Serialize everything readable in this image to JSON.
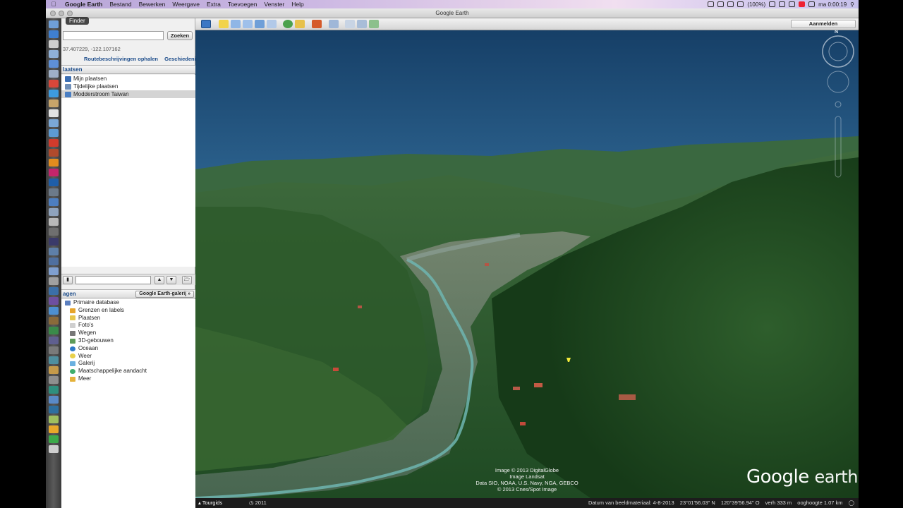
{
  "menubar": {
    "app": "Google Earth",
    "menus": [
      "Bestand",
      "Bewerken",
      "Weergave",
      "Extra",
      "Toevoegen",
      "Venster",
      "Help"
    ],
    "battery": "(100%)",
    "clock": "ma 0:00:19"
  },
  "window": {
    "title": "Google Earth"
  },
  "dock": {
    "tooltip": "Finder"
  },
  "search": {
    "button": "Zoeken",
    "coords": "37.407229, -122.107162",
    "links": [
      "Routebeschrijvingen ophalen",
      "Geschiedenis"
    ]
  },
  "places": {
    "header": "laatsen",
    "items": [
      {
        "label": "Mijn plaatsen",
        "color": "#3c6fb4"
      },
      {
        "label": "Tijdelijke plaatsen",
        "color": "#6f8fb8"
      },
      {
        "label": "Modderstroom Taiwan",
        "color": "#4a7fc4"
      }
    ]
  },
  "layers": {
    "header": "agen",
    "gallery_button": "Google Earth-galerij",
    "items": [
      {
        "label": "Primaire database",
        "indent": 0,
        "color": "#5b7fbf"
      },
      {
        "label": "Grenzen en labels",
        "indent": 1,
        "color": "#e6a42a"
      },
      {
        "label": "Plaatsen",
        "indent": 1,
        "color": "#e7c64a"
      },
      {
        "label": "Foto's",
        "indent": 1,
        "color": "#cfcfcf"
      },
      {
        "label": "Wegen",
        "indent": 1,
        "color": "#777777"
      },
      {
        "label": "3D-gebouwen",
        "indent": 1,
        "color": "#5e9b5a"
      },
      {
        "label": "Oceaan",
        "indent": 1,
        "color": "#2f7ac9"
      },
      {
        "label": "Weer",
        "indent": 1,
        "color": "#e8d04a"
      },
      {
        "label": "Galerij",
        "indent": 1,
        "color": "#6ab0e0"
      },
      {
        "label": "Maatschappelijke aandacht",
        "indent": 1,
        "color": "#3fae6b"
      },
      {
        "label": "Meer",
        "indent": 1,
        "color": "#e5b23a"
      }
    ]
  },
  "toolbar": {
    "login": "Aanmelden"
  },
  "map": {
    "compass_label": "N",
    "attribution": [
      "Image © 2013 DigitalGlobe",
      "Image Landsat",
      "Data SIO, NOAA, U.S. Navy, NGA, GEBCO",
      "© 2013 Cnes/Spot Image"
    ],
    "logo_main": "Google",
    "logo_sub": "earth"
  },
  "status": {
    "tour": "Tourgids",
    "year": "2011",
    "imagery_date": "Datum van beeldmateriaal: 4-8-2013",
    "lat": "23°01'56.03\" N",
    "lon": "120°39'56.94\" O",
    "elev": "verh  333 m",
    "eye": "ooghoogte  1.07 km"
  }
}
